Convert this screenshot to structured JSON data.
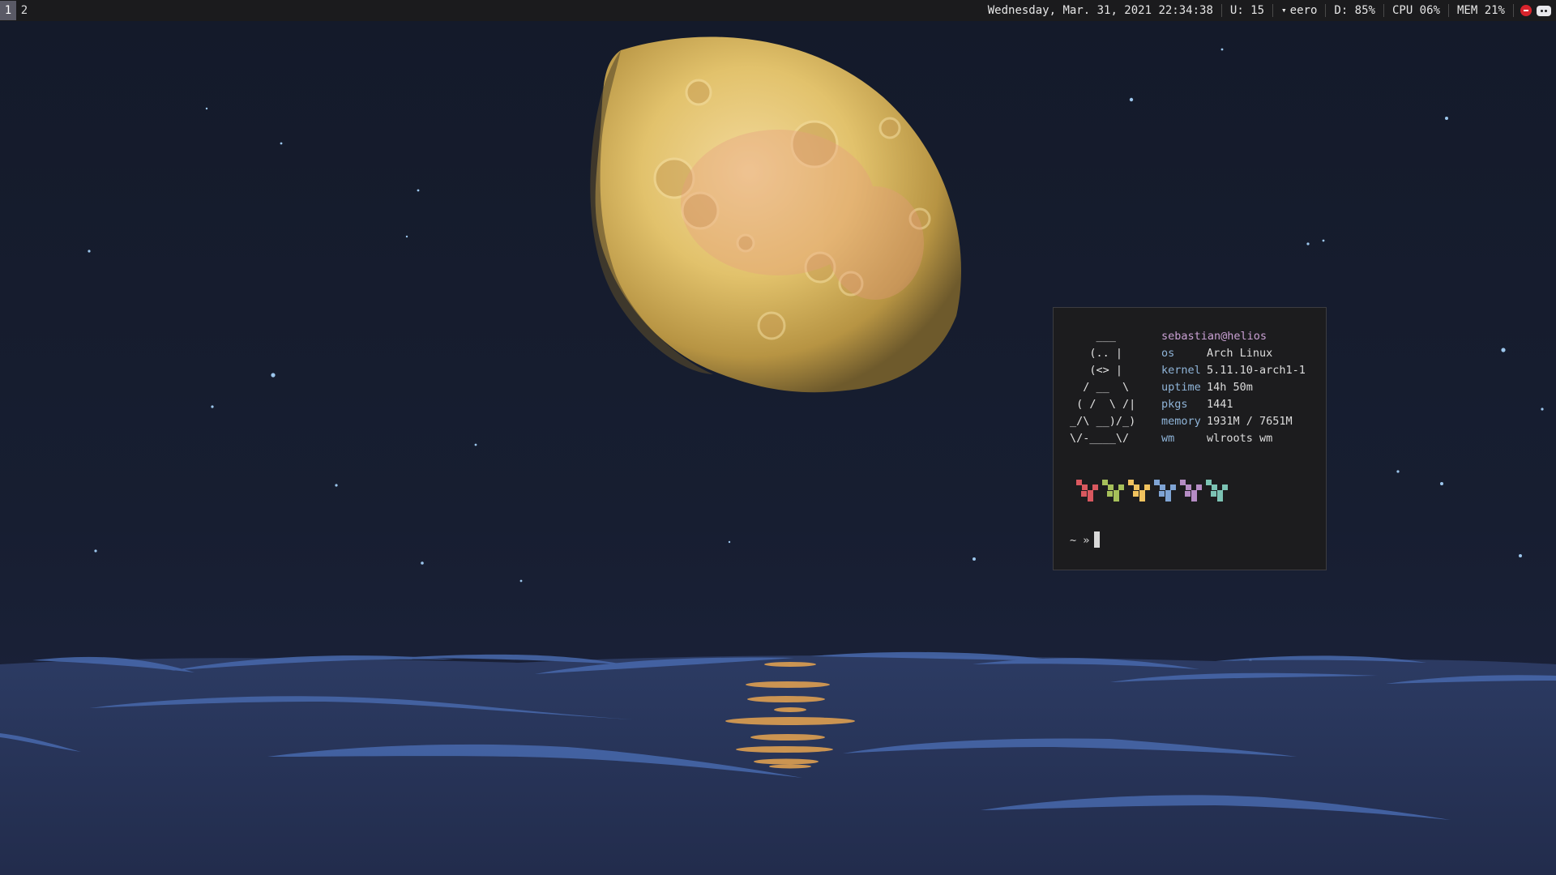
{
  "workspaces": [
    "1",
    "2"
  ],
  "statusbar": {
    "datetime": "Wednesday, Mar. 31, 2021 22:34:38",
    "updates": "U: 15",
    "wifi": "eero",
    "disk": "D: 85%",
    "cpu": "CPU 06%",
    "mem": "MEM 21%",
    "tray_icons": [
      "red-circle-icon",
      "discord-icon"
    ]
  },
  "terminal": {
    "ascii_art": "    ___\n   (.. |\n   (<> |\n  / __  \\\n ( /  \\ /|\n_/\\ __)/_)\n\\/-____\\/",
    "userhost": "sebastian@helios",
    "info": [
      {
        "key": "os",
        "value": "Arch Linux"
      },
      {
        "key": "kernel",
        "value": "5.11.10-arch1-1"
      },
      {
        "key": "uptime",
        "value": "14h 50m"
      },
      {
        "key": "pkgs",
        "value": "1441"
      },
      {
        "key": "memory",
        "value": "1931M / 7651M"
      },
      {
        "key": "wm",
        "value": "wlroots wm"
      }
    ],
    "palette_colors": [
      "#d9585f",
      "#a6c05a",
      "#f0c25e",
      "#7fa4d4",
      "#b58cc4",
      "#7cc3b4"
    ],
    "prompt": "~ »"
  },
  "wallpaper_colors": {
    "sky": "#151b2c",
    "moon": "#e2c26c",
    "sea": "#2b3a60",
    "wave": "#4666a8",
    "reflection": "#e8a550"
  }
}
